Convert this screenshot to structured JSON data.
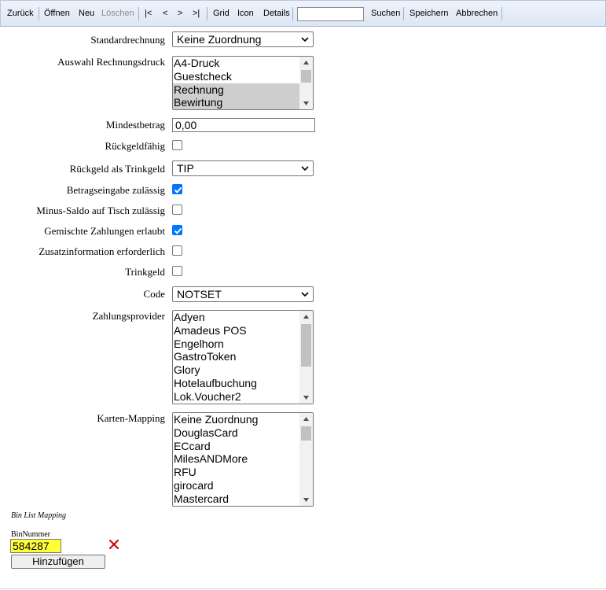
{
  "toolbar": {
    "back": "Zurück",
    "open": "Öffnen",
    "new": "Neu",
    "delete": "Löschen",
    "first": "|<",
    "prev": "<",
    "next": ">",
    "last": ">|",
    "grid": "Grid",
    "icon": "Icon",
    "details": "Details",
    "search_value": "",
    "search": "Suchen",
    "save": "Speichern",
    "cancel": "Abbrechen"
  },
  "form": {
    "standard_invoice": {
      "label": "Standardrechnung",
      "value": "Keine Zuordnung"
    },
    "print_selection": {
      "label": "Auswahl Rechnungsdruck",
      "options": [
        "A4-Druck",
        "Guestcheck",
        "Rechnung",
        "Bewirtung"
      ],
      "selected": [
        "Rechnung",
        "Bewirtung"
      ]
    },
    "min_amount": {
      "label": "Mindestbetrag",
      "value": "0,00"
    },
    "change_capable": {
      "label": "Rückgeldfähig",
      "checked": false
    },
    "change_as_tip": {
      "label": "Rückgeld als Trinkgeld",
      "value": "TIP"
    },
    "amount_entry": {
      "label": "Betragseingabe zulässig",
      "checked": true
    },
    "minus_balance": {
      "label": "Minus-Saldo auf Tisch zulässig",
      "checked": false
    },
    "mixed_payments": {
      "label": "Gemischte Zahlungen erlaubt",
      "checked": true
    },
    "additional_info": {
      "label": "Zusatzinformation erforderlich",
      "checked": false
    },
    "tip": {
      "label": "Trinkgeld",
      "checked": false
    },
    "code": {
      "label": "Code",
      "value": "NOTSET"
    },
    "payment_provider": {
      "label": "Zahlungsprovider",
      "options": [
        "Adyen",
        "Amadeus POS",
        "Engelhorn",
        "GastroToken",
        "Glory",
        "Hotelaufbuchung",
        "Lok.Voucher2"
      ]
    },
    "card_mapping": {
      "label": "Karten-Mapping",
      "options": [
        "Keine Zuordnung",
        "DouglasCard",
        "ECcard",
        "MilesANDMore",
        "RFU",
        "girocard",
        "Mastercard"
      ]
    }
  },
  "bin_section": {
    "title": "Bin List Mapping",
    "bin_label": "BinNummer",
    "bin_value": "584287",
    "add_button": "Hinzufügen"
  },
  "colors": {
    "checkbox_checked": "#0075ff",
    "bin_highlight": "#ffff3a",
    "delete_icon": "#cc0000"
  }
}
